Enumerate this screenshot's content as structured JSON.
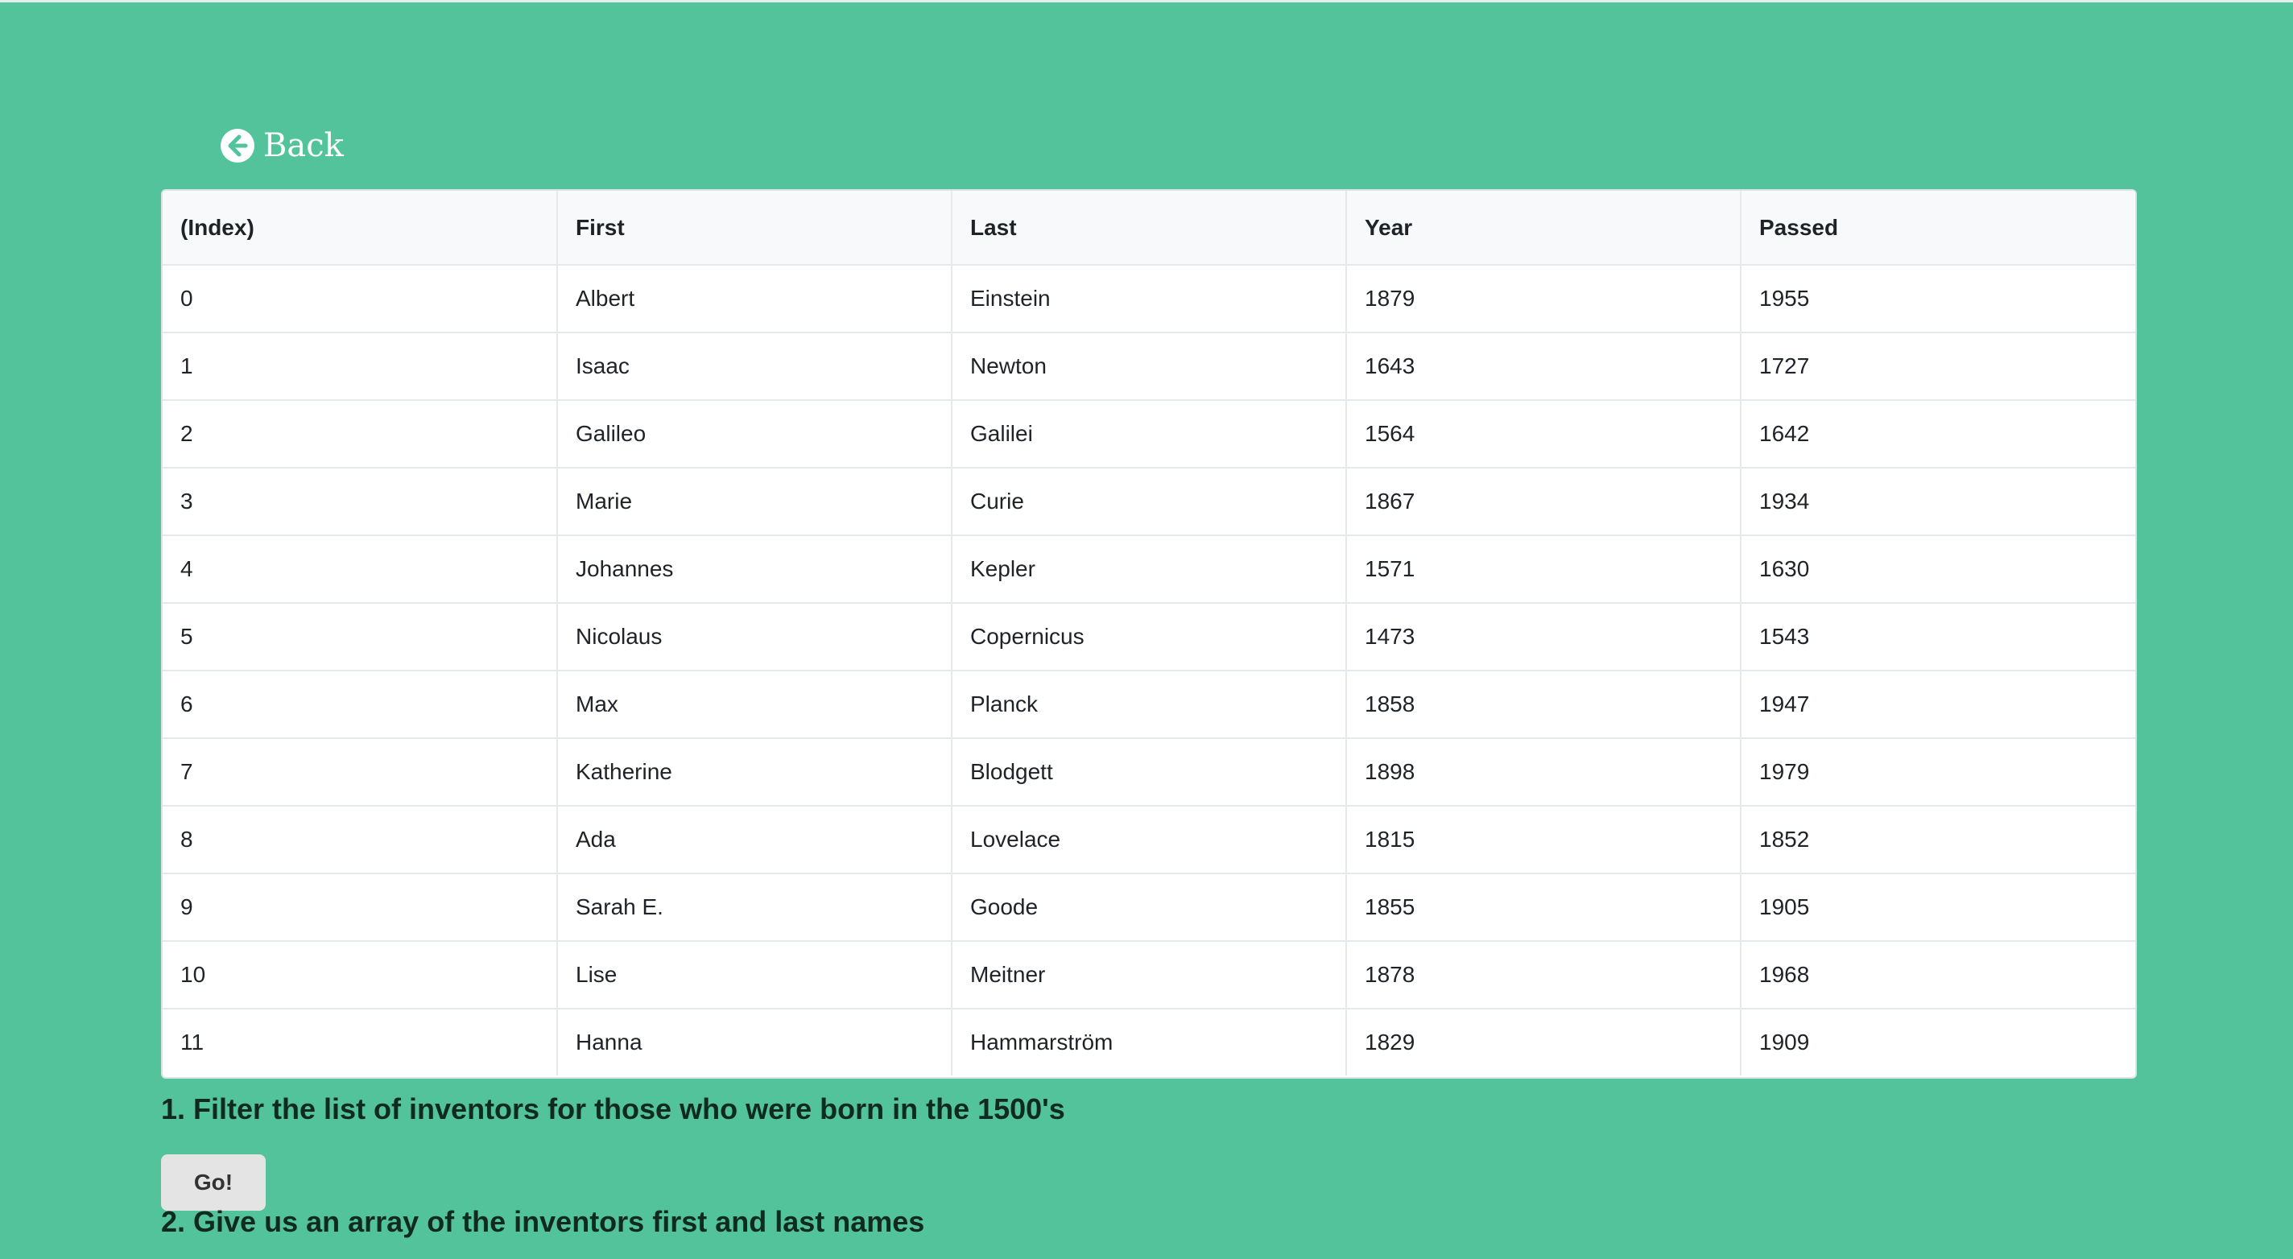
{
  "nav": {
    "back_label": "Back"
  },
  "table": {
    "headers": [
      "(Index)",
      "First",
      "Last",
      "Year",
      "Passed"
    ],
    "rows": [
      [
        "0",
        "Albert",
        "Einstein",
        "1879",
        "1955"
      ],
      [
        "1",
        "Isaac",
        "Newton",
        "1643",
        "1727"
      ],
      [
        "2",
        "Galileo",
        "Galilei",
        "1564",
        "1642"
      ],
      [
        "3",
        "Marie",
        "Curie",
        "1867",
        "1934"
      ],
      [
        "4",
        "Johannes",
        "Kepler",
        "1571",
        "1630"
      ],
      [
        "5",
        "Nicolaus",
        "Copernicus",
        "1473",
        "1543"
      ],
      [
        "6",
        "Max",
        "Planck",
        "1858",
        "1947"
      ],
      [
        "7",
        "Katherine",
        "Blodgett",
        "1898",
        "1979"
      ],
      [
        "8",
        "Ada",
        "Lovelace",
        "1815",
        "1852"
      ],
      [
        "9",
        "Sarah E.",
        "Goode",
        "1855",
        "1905"
      ],
      [
        "10",
        "Lise",
        "Meitner",
        "1878",
        "1968"
      ],
      [
        "11",
        "Hanna",
        "Hammarström",
        "1829",
        "1909"
      ]
    ]
  },
  "exercises": {
    "q1": "1. Filter the list of inventors for those who were born in the 1500's",
    "go_label": "Go!",
    "q2": "2. Give us an array of the inventors first and last names"
  },
  "colors": {
    "background": "#52c39b",
    "table_header_bg": "#f8f9fa",
    "button_bg": "#e4e4e4",
    "text": "#1f2328"
  },
  "icons": {
    "back": "arrow-circle-left-icon"
  }
}
